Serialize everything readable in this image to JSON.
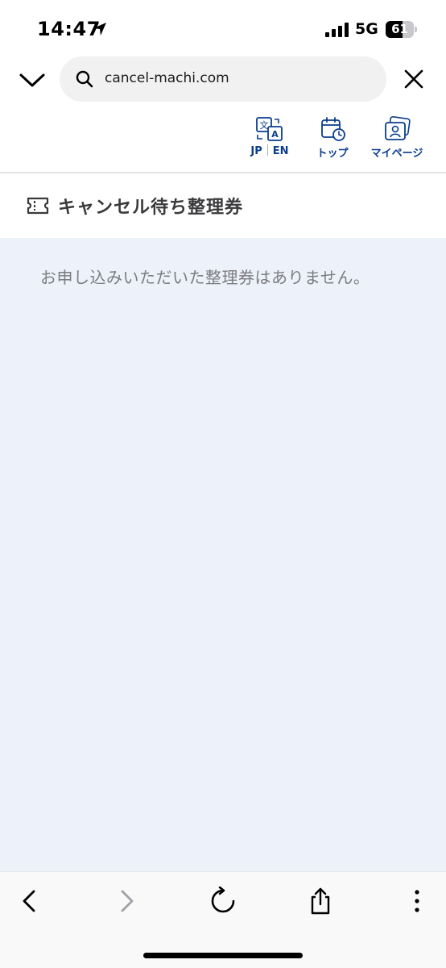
{
  "status_bar": {
    "time": "14:47",
    "network": "5G",
    "battery_level": "61",
    "battery_fraction": 0.61
  },
  "browser": {
    "url": "cancel-machi.com"
  },
  "site_nav": {
    "lang_jp": "JP",
    "lang_en": "EN",
    "top_label": "トップ",
    "mypage_label": "マイページ"
  },
  "page": {
    "title": "キャンセル待ち整理券",
    "empty_message": "お申し込みいただいた整理券はありません。"
  },
  "colors": {
    "accent": "#0a3d8f",
    "content_bg": "#ecf1fa",
    "muted_text": "#7c7c80"
  },
  "icons": {
    "location": "location-arrow-icon",
    "signal": "cellular-signal-icon",
    "collapse": "chevron-down-icon",
    "search": "search-icon",
    "close": "close-icon",
    "translate": "translate-icon",
    "calendar": "calendar-clock-icon",
    "mypage": "user-card-icon",
    "ticket": "ticket-icon",
    "back": "chevron-left-icon",
    "forward": "chevron-right-icon",
    "reload": "reload-icon",
    "share": "share-icon",
    "more": "more-vertical-icon"
  }
}
